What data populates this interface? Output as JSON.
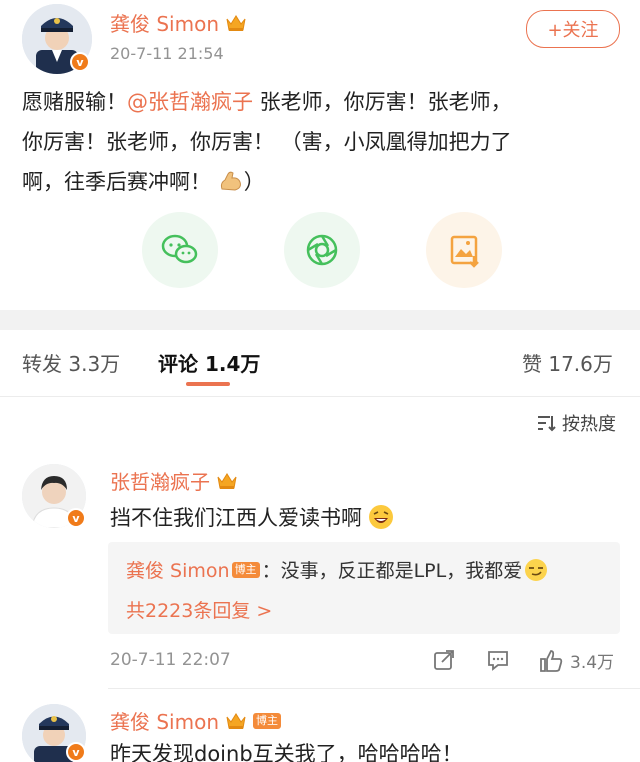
{
  "post": {
    "author": "龚俊 Simon",
    "timestamp": "20-7-11 21:54",
    "follow_label": "+关注",
    "text_prefix": "愿赌服输！",
    "mention": "@张哲瀚疯子",
    "text_line1_rest": " 张老师，你厉害！张老师，",
    "text_line2": "你厉害！张老师，你厉害！ （害，小凤凰得加把力了",
    "text_line3": "啊，往季后赛冲啊！",
    "text_line3_end": "）",
    "verified_badge": "v"
  },
  "share": {
    "icons": [
      "wechat-icon",
      "moments-icon",
      "save-image-icon"
    ],
    "colors": {
      "wechat": "#45c05c",
      "moments": "#45c05c",
      "save": "#f4a340"
    }
  },
  "tabs": {
    "repost_label": "转发",
    "repost_count": "3.3万",
    "comments_label": "评论",
    "comments_count": "1.4万",
    "likes_label": "赞",
    "likes_count": "17.6万"
  },
  "sort": {
    "label": "按热度"
  },
  "comments": [
    {
      "author": "张哲瀚疯子",
      "text": "挡不住我们江西人爱读书啊",
      "reply": {
        "author": "龚俊 Simon",
        "tag": "博主",
        "text": "：没事，反正都是LPL，我都爱"
      },
      "more_replies": "共2223条回复 >",
      "timestamp": "20-7-11 22:07",
      "like_count": "3.4万"
    },
    {
      "author": "龚俊 Simon",
      "tag": "博主",
      "text": "昨天发现doinb互关我了，哈哈哈哈！"
    }
  ],
  "colors": {
    "accent": "#eb7350",
    "divider": "#f2f2f2"
  }
}
